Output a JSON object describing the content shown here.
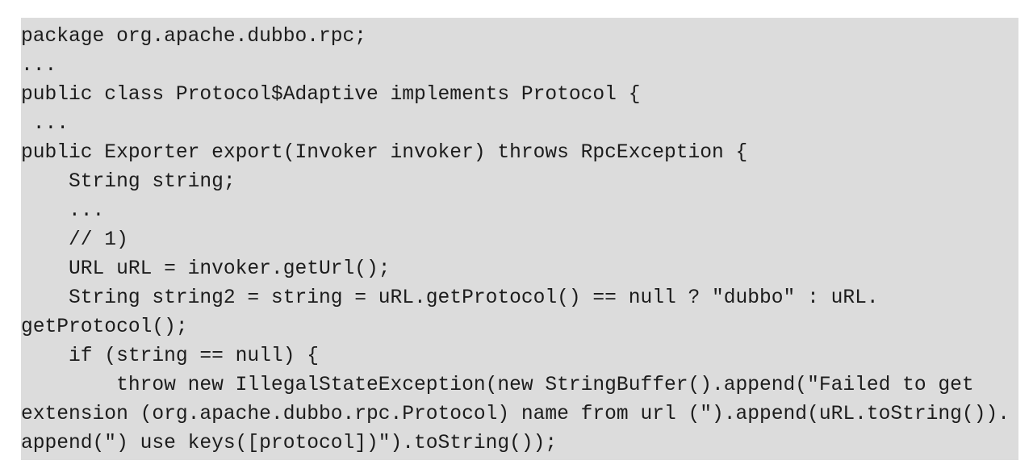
{
  "code": {
    "lines": [
      "package org.apache.dubbo.rpc;",
      "...",
      "public class Protocol$Adaptive implements Protocol {",
      " ...",
      "public Exporter export(Invoker invoker) throws RpcException {",
      "    String string;",
      "    ...",
      "    // 1)",
      "    URL uRL = invoker.getUrl();",
      "    String string2 = string = uRL.getProtocol() == null ? \"dubbo\" : uRL.",
      "getProtocol();",
      "    if (string == null) {",
      "        throw new IllegalStateException(new StringBuffer().append(\"Failed to get",
      "extension (org.apache.dubbo.rpc.Protocol) name from url (\").append(uRL.toString()).",
      "append(\") use keys([protocol])\").toString());"
    ]
  }
}
